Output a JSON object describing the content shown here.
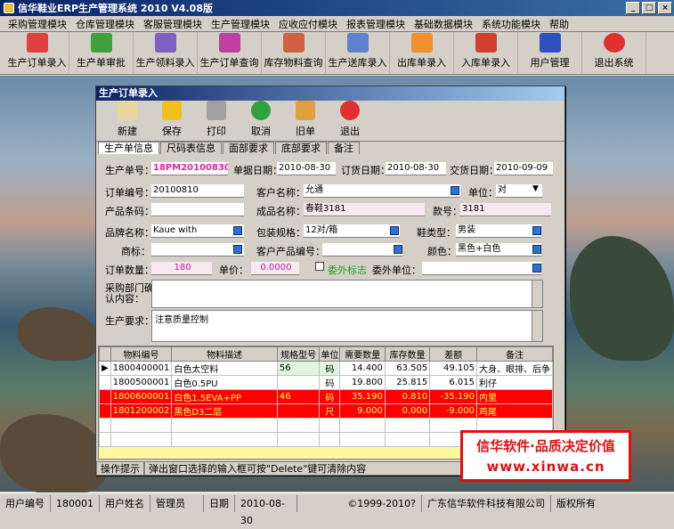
{
  "app": {
    "title": "信华鞋业ERP生产管理系统  2010 V4.08版"
  },
  "menu": [
    "采购管理模块",
    "仓库管理模块",
    "客服管理模块",
    "生产管理模块",
    "应收应付模块",
    "报表管理模块",
    "基础数据模块",
    "系统功能模块",
    "帮助"
  ],
  "toolbar": [
    "生产订单录入",
    "生产单审批",
    "生产领料录入",
    "生产订单查询",
    "库存物料查询",
    "生产送库录入",
    "出库单录入",
    "入库单录入",
    "用户管理",
    "退出系统"
  ],
  "window": {
    "title": "生产订单录入",
    "tools": [
      "新建",
      "保存",
      "打印",
      "取消",
      "旧单",
      "退出"
    ],
    "tabs": [
      "生产单信息",
      "尺码表信息",
      "面部要求",
      "底部要求",
      "备注"
    ]
  },
  "form": {
    "order_no_label": "生产单号：",
    "order_no": "18PM20100830001",
    "order_date_label": "单据日期：",
    "order_date": "2010-08-30",
    "book_date_label": "订货日期：",
    "book_date": "2010-08-30",
    "deliver_date_label": "交货日期：",
    "deliver_date": "2010-09-09",
    "order_code_label": "订单编号：",
    "order_code": "20100810",
    "customer_label": "客户名称：",
    "customer": "允通",
    "unit_label": "单位：",
    "unit": "对",
    "barcode_label": "产品条码：",
    "barcode": "",
    "product_label": "成品名称：",
    "product": "春鞋3181",
    "style_no_label": "款号：",
    "style_no": "3181",
    "brand_label": "品牌名称：",
    "brand": "Kaue with",
    "pack_label": "包装规格：",
    "pack": "12对/箱",
    "type_label": "鞋类型：",
    "type": "男装",
    "trademark_label": "商标：",
    "trademark": "",
    "cust_code_label": "客户产品编号：",
    "cust_code": "",
    "color_label": "颜色：",
    "color": "黑色+白色",
    "qty_label": "订单数量：",
    "qty": "180",
    "price_label": "单价：",
    "price": "0.0000",
    "outsource_label": "委外标志",
    "outsource_unit_label": "委外单位：",
    "outsource_unit": "",
    "purchase_confirm_label": "采购部门确认内容：",
    "purchase_confirm": "",
    "requirement_label": "生产要求：",
    "requirement": "注意质量控制"
  },
  "grid": {
    "headers": [
      "物料编号",
      "物料描述",
      "规格型号",
      "单位",
      "需要数量",
      "库存数量",
      "差额",
      "备注"
    ],
    "rows": [
      {
        "code": "1800400001",
        "desc": "白色太空料",
        "spec": "56",
        "unit": "码",
        "need": "14.400",
        "stock": "63.505",
        "diff": "49.105",
        "note": "大身、眼排、后争"
      },
      {
        "code": "1800500001",
        "desc": "白色0.5PU",
        "spec": "",
        "unit": "码",
        "need": "19.800",
        "stock": "25.815",
        "diff": "6.015",
        "note": "利仔"
      },
      {
        "code": "1800600001",
        "desc": "白色1.5EVA+PP",
        "spec": "46",
        "unit": "码",
        "need": "35.190",
        "stock": "0.810",
        "diff": "-35.190",
        "note": "内里"
      },
      {
        "code": "1801200002",
        "desc": "黑色D3二层",
        "spec": "",
        "unit": "尺",
        "need": "9.000",
        "stock": "0.000",
        "diff": "-9.000",
        "note": "鸡尾"
      }
    ]
  },
  "hint": {
    "label": "操作提示",
    "text": "弹出窗口选择的输入框可按\"Delete\"键可清除内容"
  },
  "status": {
    "user_no_label": "用户编号",
    "user_no": "180001",
    "user_name_label": "用户姓名",
    "user_name": "管理员",
    "date_label": "日期",
    "date": "2010-08-30",
    "copyright": "©1999-2010?",
    "company": "广东信华软件科技有限公司",
    "rights": "版权所有"
  },
  "promo": {
    "line1": "信华软件·品质决定价值",
    "line2": "www.xinwa.cn"
  }
}
